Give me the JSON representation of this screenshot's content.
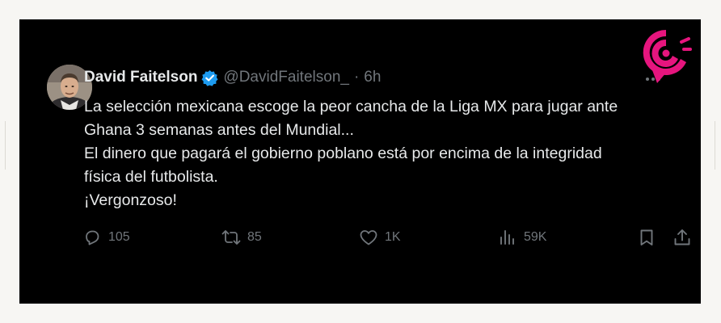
{
  "tweet": {
    "author_name": "David Faitelson",
    "handle": "@DavidFaitelson_",
    "separator": "·",
    "time": "6h",
    "lines": [
      "La selección mexicana escoge la peor cancha de la Liga MX para jugar ante",
      "Ghana 3 semanas antes del Mundial...",
      "El dinero que pagará el gobierno poblano está por encima de la integridad",
      "física del futbolista.",
      "¡Vergonzoso!"
    ]
  },
  "actions": {
    "replies": "105",
    "reposts": "85",
    "likes": "1K",
    "views": "59K"
  },
  "colors": {
    "background": "#000000",
    "text": "#e7e9ea",
    "muted": "#71767b",
    "verified": "#1d9bf0",
    "watermark": "#e6157e"
  },
  "icons": [
    "verified-badge-icon",
    "more-icon",
    "reply-icon",
    "repost-icon",
    "like-icon",
    "views-icon",
    "bookmark-icon",
    "share-icon"
  ]
}
